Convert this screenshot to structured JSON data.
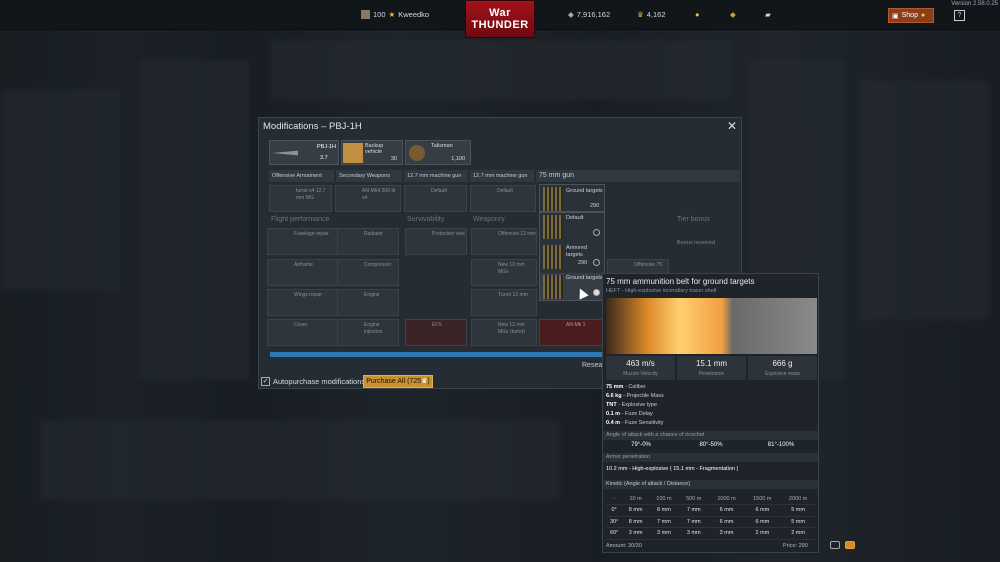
{
  "topbar": {
    "version": "Version 2.58.0.25",
    "eagles_val": "100",
    "username": "Kweedko",
    "logo_line1": "War",
    "logo_line2": "THUNDER",
    "silver": "7,916,162",
    "gold": "4,162",
    "shop": "Shop",
    "help": "?"
  },
  "window": {
    "title": "Modifications – PBJ-1H",
    "close": "✕",
    "vehicle": {
      "name": "PBJ-1H",
      "br": "3.7",
      "backup_label": "Backup vehicle",
      "backup_count": "30",
      "talisman_label": "Talisman",
      "talisman_cost": "1,100"
    },
    "tabs": [
      "Offensive Armament",
      "Secondary Weapons",
      "12.7 mm machine gun",
      "12.7 mm machine gun",
      "75 mm gun"
    ],
    "slots": [
      "turret x4 12.7 mm MG",
      "AN-M64 500 lb x4",
      "Default",
      "Default"
    ],
    "sections": [
      "Flight performance",
      "Survivability",
      "Weaponry",
      "Tier bonus"
    ],
    "mods": [
      "Fuselage repair",
      "Radiator",
      "Protective vest",
      "Offensive 12 mm",
      "Airframe",
      "Compressor",
      "New 12 mm MGs",
      "Wings repair",
      "Engine",
      "Turret 12 mm",
      "Cover",
      "Engine injection",
      "EFS",
      "New 12 mm MGs (turret)",
      "AN-Mk 1",
      "Offensive 75"
    ],
    "bonus": "Bonus received",
    "autopurchase": "Autopurchase modifications",
    "purchase_all": "Purchase All (725",
    "research": "Resear"
  },
  "dropdown": {
    "current": "Ground targets",
    "current_price": "290",
    "items": [
      {
        "label": "Default"
      },
      {
        "label": "Armored targets",
        "price": "290"
      },
      {
        "label": "Ground targets",
        "price": "290"
      }
    ]
  },
  "tooltip": {
    "title": "75 mm ammunition belt for ground targets",
    "subtitle": "HEFT - High-explosive incendiary tracer shell",
    "stats": [
      {
        "value": "463 m/s",
        "label": "Muzzle Velocity"
      },
      {
        "value": "15.1 mm",
        "label": "Penetration"
      },
      {
        "value": "666 g",
        "label": "Explosive mass"
      }
    ],
    "specs": [
      {
        "v": "75 mm",
        "k": " - Caliber"
      },
      {
        "v": "6.6 kg",
        "k": " - Projectile Mass"
      },
      {
        "v": "TNT",
        "k": " - Explosive type"
      },
      {
        "v": "0.1 m",
        "k": " - Fuze Delay"
      },
      {
        "v": "0.4 m",
        "k": " - Fuze Sensitivity"
      }
    ],
    "ricochet_header": "Angle of attack with a chance of ricochet",
    "ricochet": [
      "79°-0%",
      "80°-50%",
      "81°-100%"
    ],
    "armor_header": "Armor penetration",
    "armor_line": "10.2 mm - High-explosive ( 15.1 mm - Fragmentation )",
    "kinetic_header": "Kinetic (Angle of attack / Distance)",
    "table": [
      [
        "-",
        "10 m",
        "100 m",
        "500 m",
        "1000 m",
        "1500 m",
        "2000 m"
      ],
      [
        "0°",
        "8 mm",
        "8 mm",
        "7 mm",
        "6 mm",
        "6 mm",
        "5 mm"
      ],
      [
        "30°",
        "8 mm",
        "7 mm",
        "7 mm",
        "6 mm",
        "6 mm",
        "5 mm"
      ],
      [
        "60°",
        "3 mm",
        "3 mm",
        "3 mm",
        "3 mm",
        "2 mm",
        "2 mm"
      ]
    ],
    "amount": "Amount: 30/30",
    "price": "Price: 290"
  }
}
